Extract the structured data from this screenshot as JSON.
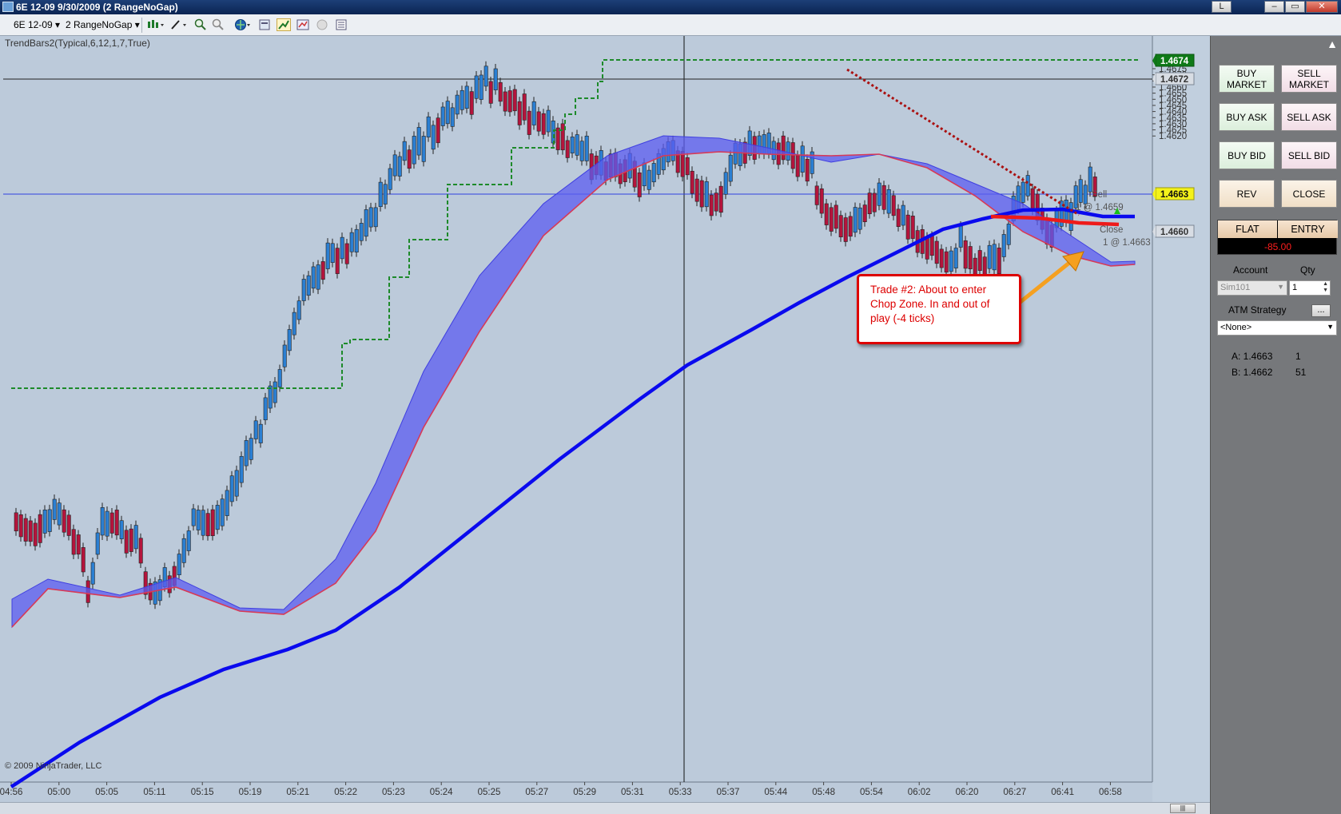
{
  "window": {
    "title": "6E 12-09  9/30/2009 (2 RangeNoGap)",
    "btn_l": "L",
    "btn_min": "–",
    "btn_max": "▭",
    "btn_close": "✕"
  },
  "toolbar": {
    "instrument": "6E 12-09 ▾",
    "period": "2 RangeNoGap ▾"
  },
  "chart": {
    "indicator_label": "TrendBars2(Typical,6,12,1,7,True)",
    "copyright": "© 2009 NinjaTrader, LLC",
    "price_labels": [
      "1.4675",
      "1.4670",
      "1.4665",
      "1.4660",
      "1.4655",
      "1.4650",
      "1.4645",
      "1.4640",
      "1.4635",
      "1.4630",
      "1.4625",
      "1.4620"
    ],
    "time_labels": [
      "04:56",
      "05:00",
      "05:05",
      "05:11",
      "05:15",
      "05:19",
      "05:21",
      "05:22",
      "05:23",
      "05:24",
      "05:25",
      "05:27",
      "05:29",
      "05:31",
      "05:33",
      "05:37",
      "05:44",
      "05:48",
      "05:54",
      "06:02",
      "06:20",
      "06:27",
      "06:41",
      "06:58"
    ],
    "price_tag_1": "1.4674",
    "price_tag_2": "1.4672",
    "price_tag_3": "1.4663",
    "price_tag_4": "1.4660",
    "marker_sell": "Sell",
    "marker_sell_px": "1 @ 1.4659",
    "marker_close": "Close",
    "marker_close_px": "1 @ 1.4663",
    "annotation": "Trade #2: About to enter Chop Zone.  In and out of play (-4 ticks)",
    "colors": {
      "up_bar": "#2b7fd2",
      "down_bar": "#b4143c",
      "slow_ema": "#0a0aee",
      "stops": "#1d8a2a",
      "annotation_border": "#dd0000"
    }
  },
  "panel": {
    "buy_market": "BUY MARKET",
    "sell_market": "SELL MARKET",
    "buy_ask": "BUY ASK",
    "sell_ask": "SELL ASK",
    "buy_bid": "BUY BID",
    "sell_bid": "SELL BID",
    "rev": "REV",
    "close": "CLOSE",
    "flat": "FLAT",
    "entry": "ENTRY",
    "pnl": "-85.00",
    "account_label": "Account",
    "qty_label": "Qty",
    "account": "Sim101",
    "qty": "1",
    "atm_label": "ATM Strategy",
    "atm_btn": "...",
    "atm_value": "<None>",
    "ask_label": "A: 1.4663",
    "ask_size": "1",
    "bid_label": "B: 1.4662",
    "bid_size": "51"
  }
}
